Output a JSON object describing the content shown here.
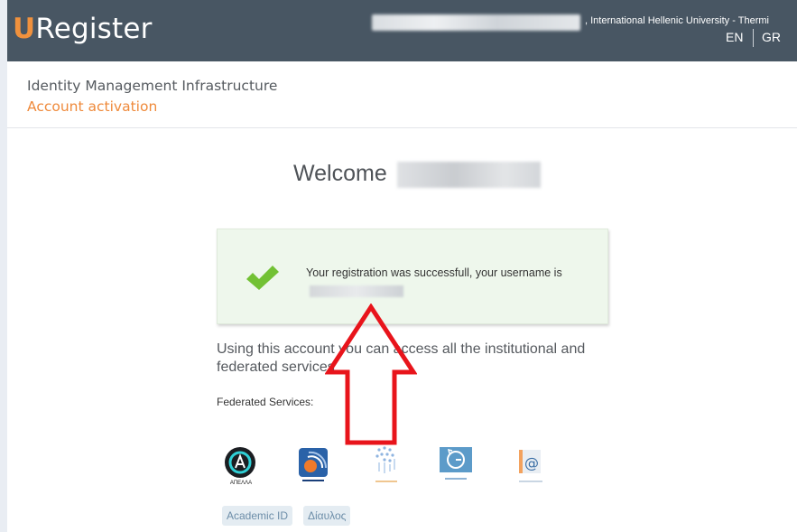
{
  "header": {
    "logo_initial": "U",
    "logo_rest": "Register",
    "institution": ", International Hellenic University - Thermi",
    "languages": [
      "EN",
      "GR"
    ]
  },
  "page": {
    "title": "Identity Management Infrastructure",
    "subtitle": "Account activation"
  },
  "main": {
    "welcome": "Welcome",
    "success_message": "Your registration was successfull, your username is",
    "usage_text": "Using this account you can access all the institutional and federated services",
    "federated_label": "Federated Services:",
    "services": [
      {
        "name": "ΑΠΕΛΛΑ",
        "icon": "apella-logo"
      },
      {
        "name": "eduroam",
        "icon": "eduroam-logo"
      },
      {
        "name": "",
        "icon": "network-logo"
      },
      {
        "name": "",
        "icon": "sync-logo"
      },
      {
        "name": "",
        "icon": "email-logo"
      }
    ],
    "tags": [
      "Academic ID",
      "Δίαυλος"
    ]
  },
  "colors": {
    "topbar": "#485663",
    "accent": "#ef8a3b",
    "success_bg": "#eef7ec",
    "check": "#72c134",
    "arrow": "#e8141b"
  }
}
